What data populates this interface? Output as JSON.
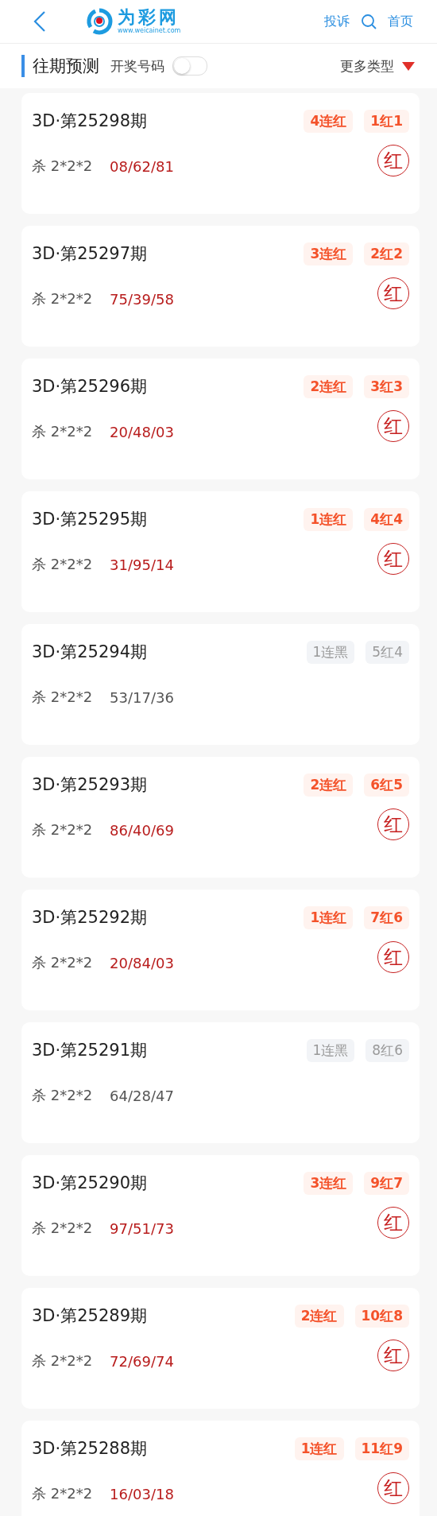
{
  "header": {
    "logo_name": "为彩网",
    "logo_url": "www.weicainet.com",
    "links": [
      "投诉",
      "首页"
    ]
  },
  "section": {
    "title": "往期预测",
    "toggle_label": "开奖号码",
    "toggle_on": false,
    "more": "更多类型"
  },
  "cards": [
    {
      "title": "3D·第25298期",
      "streak": "4连红",
      "count": "1红1",
      "kill": "杀 2*2*2",
      "numbers": "08/62/81",
      "hit": true,
      "result": "红"
    },
    {
      "title": "3D·第25297期",
      "streak": "3连红",
      "count": "2红2",
      "kill": "杀 2*2*2",
      "numbers": "75/39/58",
      "hit": true,
      "result": "红"
    },
    {
      "title": "3D·第25296期",
      "streak": "2连红",
      "count": "3红3",
      "kill": "杀 2*2*2",
      "numbers": "20/48/03",
      "hit": true,
      "result": "红"
    },
    {
      "title": "3D·第25295期",
      "streak": "1连红",
      "count": "4红4",
      "kill": "杀 2*2*2",
      "numbers": "31/95/14",
      "hit": true,
      "result": "红"
    },
    {
      "title": "3D·第25294期",
      "streak": "1连黑",
      "count": "5红4",
      "kill": "杀 2*2*2",
      "numbers": "53/17/36",
      "hit": false
    },
    {
      "title": "3D·第25293期",
      "streak": "2连红",
      "count": "6红5",
      "kill": "杀 2*2*2",
      "numbers": "86/40/69",
      "hit": true,
      "result": "红"
    },
    {
      "title": "3D·第25292期",
      "streak": "1连红",
      "count": "7红6",
      "kill": "杀 2*2*2",
      "numbers": "20/84/03",
      "hit": true,
      "result": "红"
    },
    {
      "title": "3D·第25291期",
      "streak": "1连黑",
      "count": "8红6",
      "kill": "杀 2*2*2",
      "numbers": "64/28/47",
      "hit": false
    },
    {
      "title": "3D·第25290期",
      "streak": "3连红",
      "count": "9红7",
      "kill": "杀 2*2*2",
      "numbers": "97/51/73",
      "hit": true,
      "result": "红"
    },
    {
      "title": "3D·第25289期",
      "streak": "2连红",
      "count": "10红8",
      "kill": "杀 2*2*2",
      "numbers": "72/69/74",
      "hit": true,
      "result": "红"
    },
    {
      "title": "3D·第25288期",
      "streak": "1连红",
      "count": "11红9",
      "kill": "杀 2*2*2",
      "numbers": "16/03/18",
      "hit": true,
      "result": "红"
    }
  ]
}
